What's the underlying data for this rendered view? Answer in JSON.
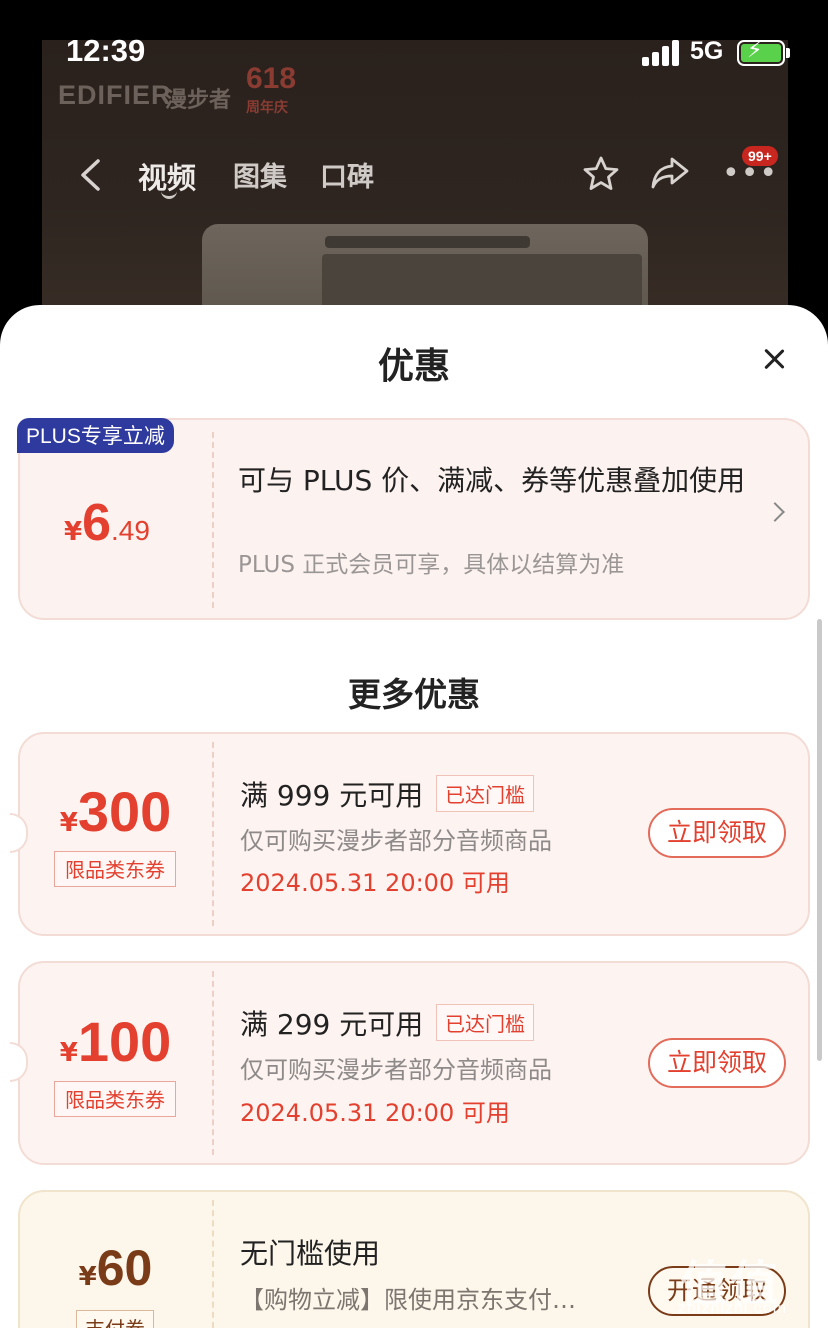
{
  "status_bar": {
    "time": "12:39",
    "network": "5G"
  },
  "hero": {
    "brand": "EDIFIER",
    "brand_cn": "漫步者",
    "promo": "618",
    "promo_sub": "周年庆"
  },
  "nav": {
    "tabs": [
      {
        "label": "视频",
        "active": true
      },
      {
        "label": "图集",
        "active": false
      },
      {
        "label": "口碑",
        "active": false
      }
    ],
    "more_badge": "99+"
  },
  "sheet": {
    "title": "优惠",
    "plus": {
      "tag_prefix": "PLUS",
      "tag_suffix": "专享立减",
      "currency": "¥",
      "amount_int": "6",
      "amount_dec": ".49",
      "title": "可与 PLUS 价、满减、券等优惠叠加使用",
      "subtitle": "PLUS 正式会员可享，具体以结算为准"
    },
    "more_title": "更多优惠",
    "coupons": [
      {
        "currency": "¥",
        "amount": "300",
        "type": "限品类东券",
        "title": "满 999 元可用",
        "badge": "已达门槛",
        "desc": "仅可购买漫步者部分音频商品",
        "date": "2024.05.31 20:00 可用",
        "button": "立即领取"
      },
      {
        "currency": "¥",
        "amount": "100",
        "type": "限品类东券",
        "title": "满 299 元可用",
        "badge": "已达门槛",
        "desc": "仅可购买漫步者部分音频商品",
        "date": "2024.05.31 20:00 可用",
        "button": "立即领取"
      },
      {
        "currency": "¥",
        "amount": "60",
        "type": "支付券",
        "title": "无门槛使用",
        "desc": "【购物立减】限使用京东支付…",
        "button": "开通领取"
      }
    ]
  },
  "watermark": {
    "chars": "值值值",
    "url": "zhizhizhi.com"
  },
  "colors": {
    "accent": "#e3402f",
    "plus_blue": "#2f3a9e",
    "gold_text": "#7a3c18"
  },
  "icons": [
    "back-icon",
    "star-icon",
    "share-icon",
    "more-icon",
    "close-icon",
    "chevron-right-icon",
    "battery-icon",
    "signal-icon"
  ]
}
